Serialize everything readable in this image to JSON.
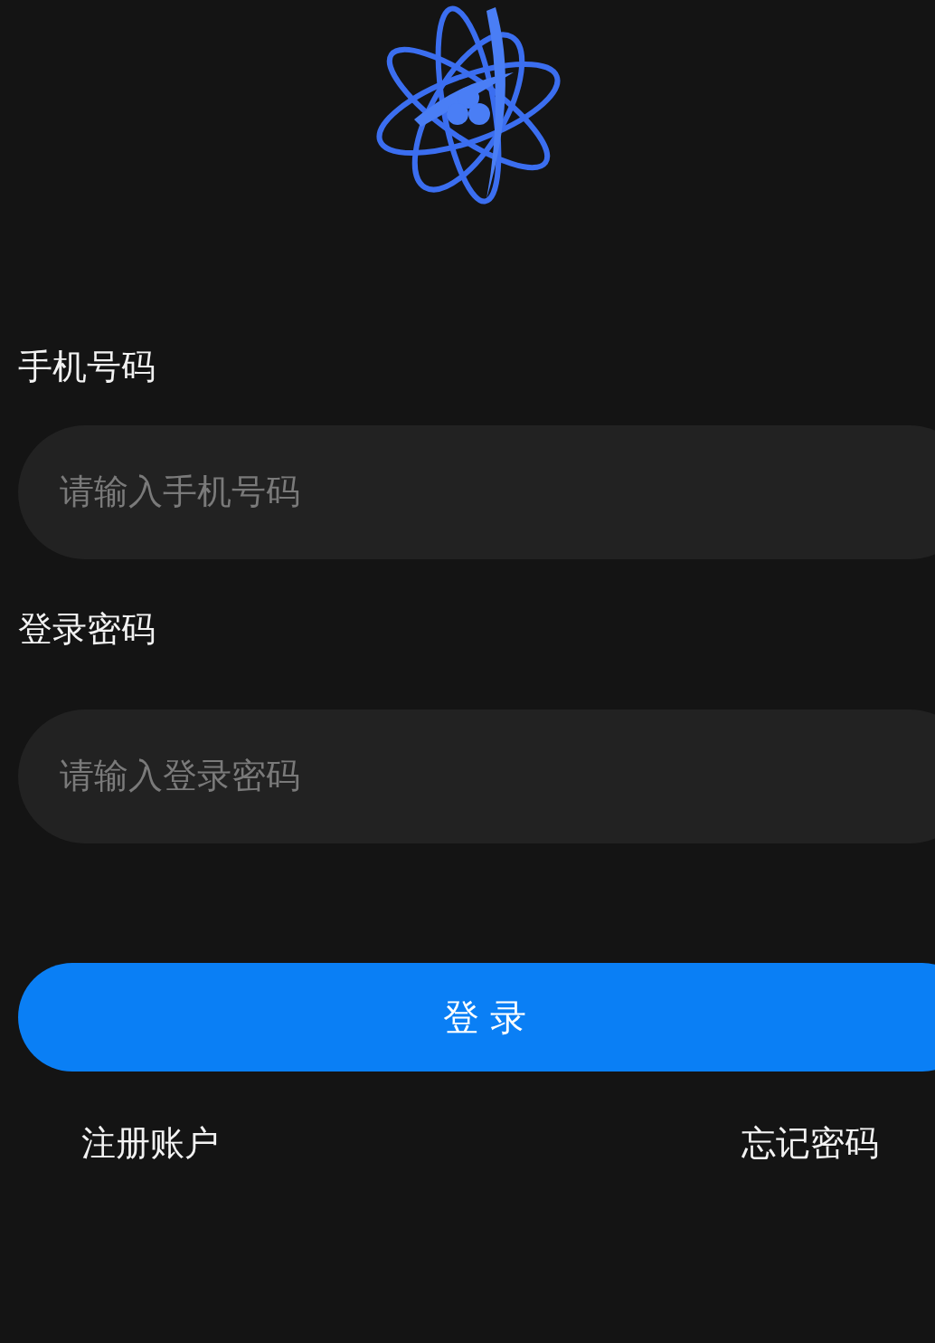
{
  "fields": [
    {
      "label": "手机号码",
      "placeholder": "请输入手机号码"
    },
    {
      "label": "登录密码",
      "placeholder": "请输入登录密码"
    }
  ],
  "submit_button": "登 录",
  "links": [
    "注册账户",
    "忘记密码"
  ]
}
